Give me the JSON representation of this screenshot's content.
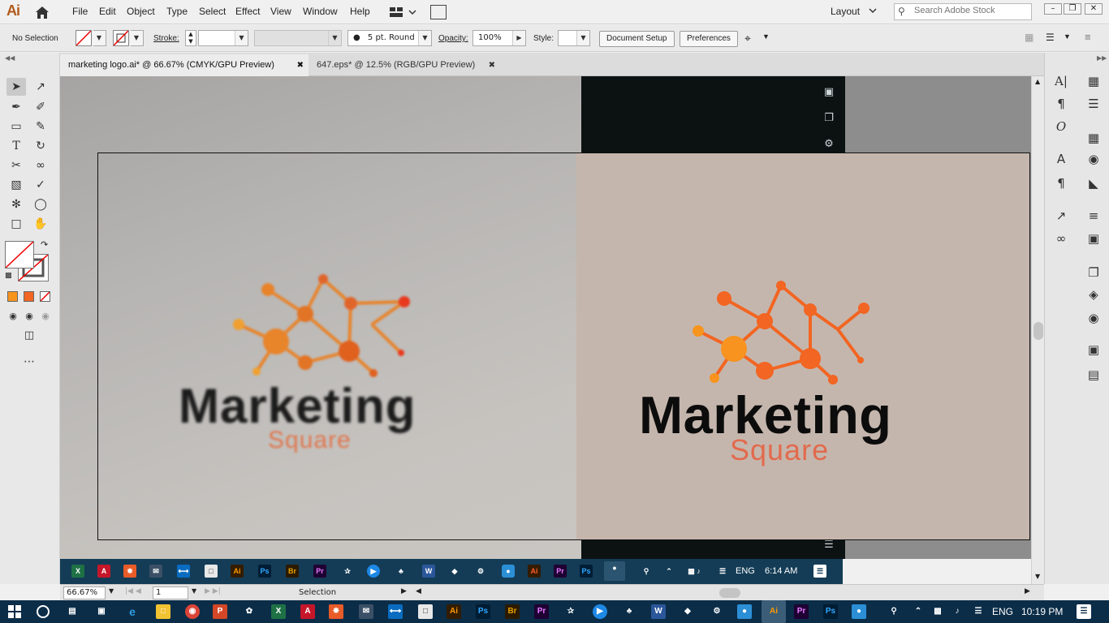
{
  "app": {
    "logo": "Ai"
  },
  "menu": [
    "File",
    "Edit",
    "Object",
    "Type",
    "Select",
    "Effect",
    "View",
    "Window",
    "Help"
  ],
  "workspace": {
    "layout_label": "Layout",
    "search_placeholder": "Search Adobe Stock"
  },
  "control_bar": {
    "selection_label": "No Selection",
    "stroke_label": "Stroke:",
    "brush": "5 pt. Round",
    "opacity_label": "Opacity:",
    "opacity_value": "100%",
    "style_label": "Style:",
    "document_setup": "Document Setup",
    "preferences": "Preferences"
  },
  "tabs": [
    {
      "label": "marketing logo.ai* @ 66.67% (CMYK/GPU Preview)",
      "active": true
    },
    {
      "label": "647.eps* @ 12.5% (RGB/GPU Preview)",
      "active": false
    }
  ],
  "artwork": {
    "left_title": "Marketing",
    "left_sub": "Square",
    "right_title": "Marketing",
    "right_sub": "Square",
    "colors": {
      "orange": "#f26522",
      "light_orange": "#f7931e",
      "red_orange": "#e64a19",
      "square_text": "#e26a4d"
    }
  },
  "inner_taskbar": {
    "lang": "ENG",
    "time": "6:14 AM"
  },
  "status_bar": {
    "zoom": "66.67%",
    "artboard": "1",
    "tool": "Selection"
  },
  "taskbar": {
    "lang": "ENG",
    "time": "10:19 PM"
  }
}
